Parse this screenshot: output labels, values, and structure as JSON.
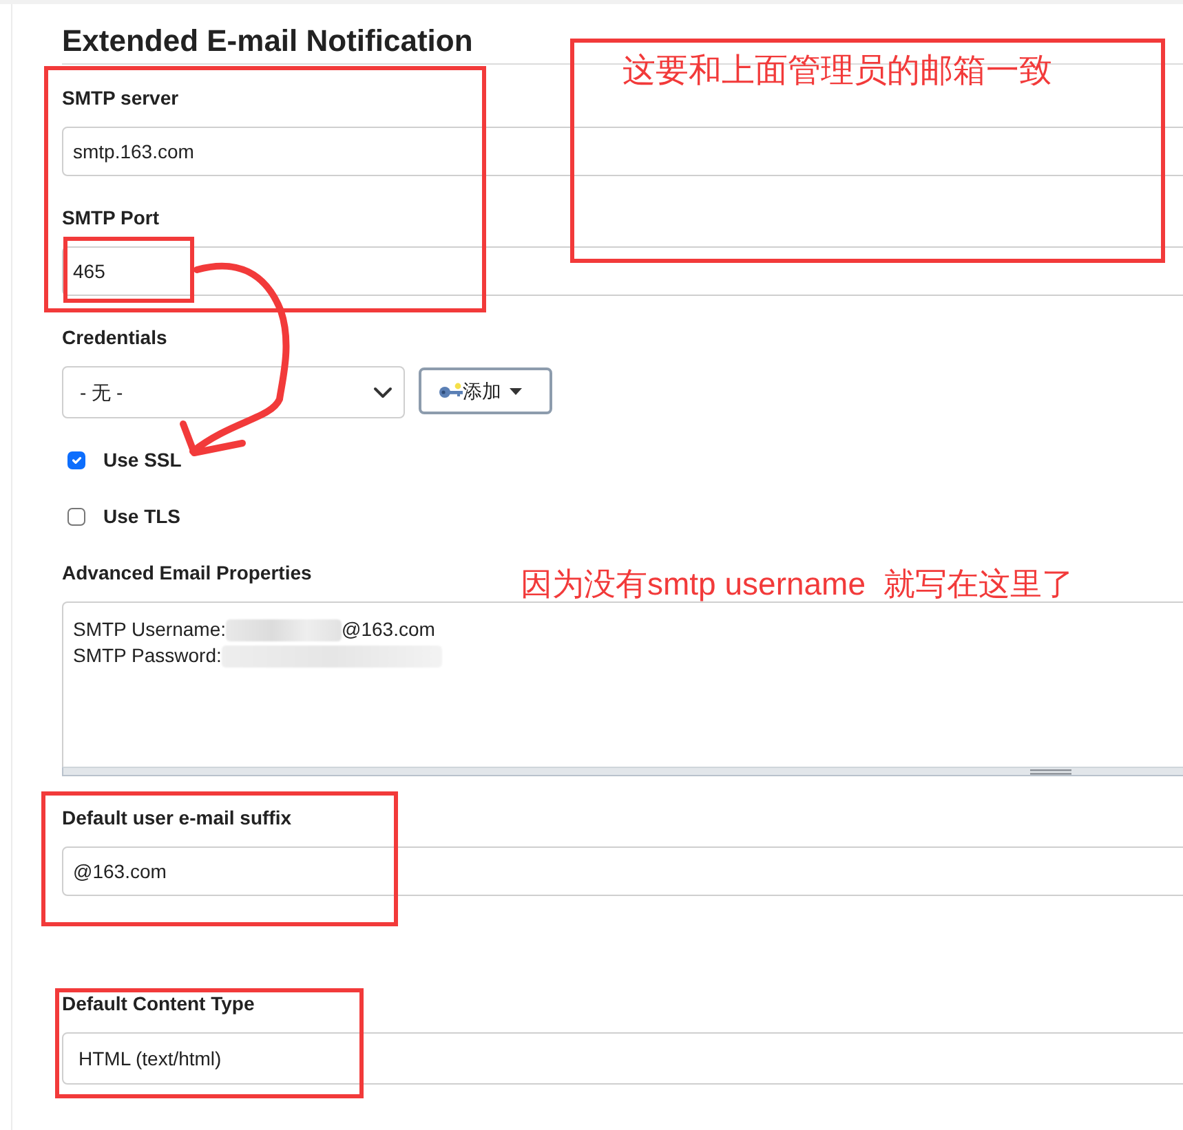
{
  "section": {
    "title": "Extended E-mail Notification"
  },
  "fields": [
    {
      "kind": "text",
      "label": "SMTP server",
      "value": "smtp.163.com"
    },
    {
      "kind": "text",
      "label": "SMTP Port",
      "value": "465"
    },
    {
      "kind": "credentials",
      "label": "Credentials",
      "value": "- 无 -",
      "button": "添加"
    },
    {
      "kind": "checkbox",
      "label": "Use SSL",
      "checked": true
    },
    {
      "kind": "checkbox",
      "label": "Use TLS",
      "checked": false
    },
    {
      "kind": "textarea",
      "label": "Advanced Email Properties",
      "lines": [
        [
          {
            "kind": "text",
            "text": "SMTP Username:"
          },
          {
            "kind": "redacted"
          },
          {
            "kind": "text",
            "text": "@163.com"
          }
        ],
        [
          {
            "kind": "text",
            "text": "SMTP Password:"
          },
          {
            "kind": "redacted"
          }
        ]
      ]
    },
    {
      "kind": "text",
      "label": "Default user e-mail suffix",
      "value": "@163.com"
    },
    {
      "kind": "select",
      "label": "Default Content Type",
      "value": "HTML (text/html)"
    }
  ],
  "annotations": [
    {
      "kind": "box"
    },
    {
      "kind": "box"
    },
    {
      "kind": "box",
      "text": "这要和上面管理员的邮箱一致"
    },
    {
      "kind": "arrow"
    },
    {
      "kind": "note",
      "text": "因为没有smtp username  就写在这里了"
    },
    {
      "kind": "box"
    },
    {
      "kind": "box"
    }
  ]
}
